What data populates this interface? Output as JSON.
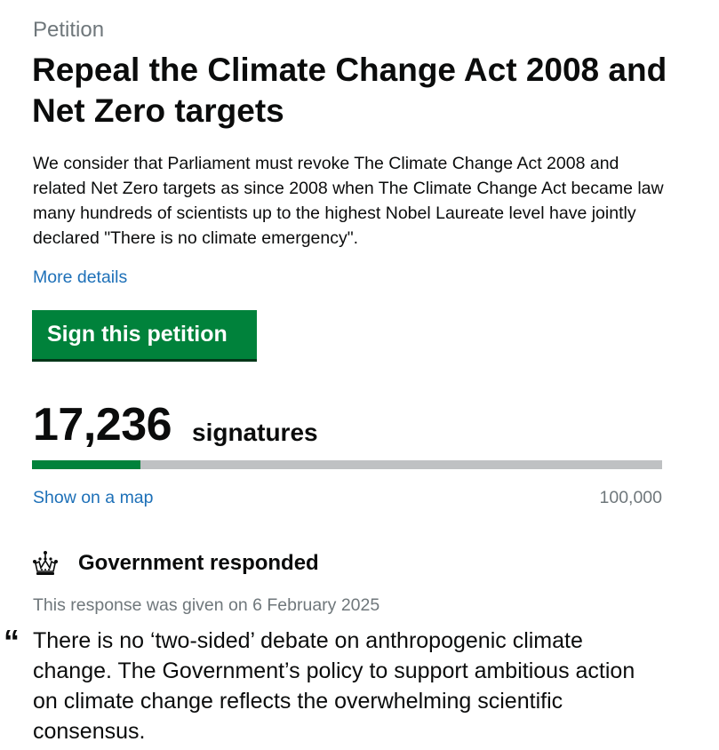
{
  "petition": {
    "caption": "Petition",
    "title": "Repeal the Climate Change Act 2008 and Net Zero targets",
    "summary": "We consider that Parliament must revoke The Climate Change Act 2008 and related Net Zero targets as since 2008 when The Climate Change Act became law many hundreds of scientists up to the highest Nobel Laureate level have jointly declared \"There is no climate emergency\".",
    "more_details_label": "More details",
    "sign_button_label": "Sign this petition"
  },
  "signatures": {
    "count": "17,236",
    "label": "signatures",
    "progress_fraction": 0.17236,
    "show_on_map_label": "Show on a map",
    "target": "100,000"
  },
  "response": {
    "icon": "crown-icon",
    "heading": "Government responded",
    "date_text": "This response was given on 6 February 2025",
    "quote_mark": "“",
    "quote": "There is no ‘two-sided’ debate on anthropogenic climate change. The Government’s policy to support ambitious action on climate change reflects the overwhelming scientific consensus."
  },
  "colors": {
    "accent_green": "#00823b",
    "link_blue": "#1d70b8",
    "secondary_grey": "#6f777b",
    "track_grey": "#bfc1c3"
  }
}
